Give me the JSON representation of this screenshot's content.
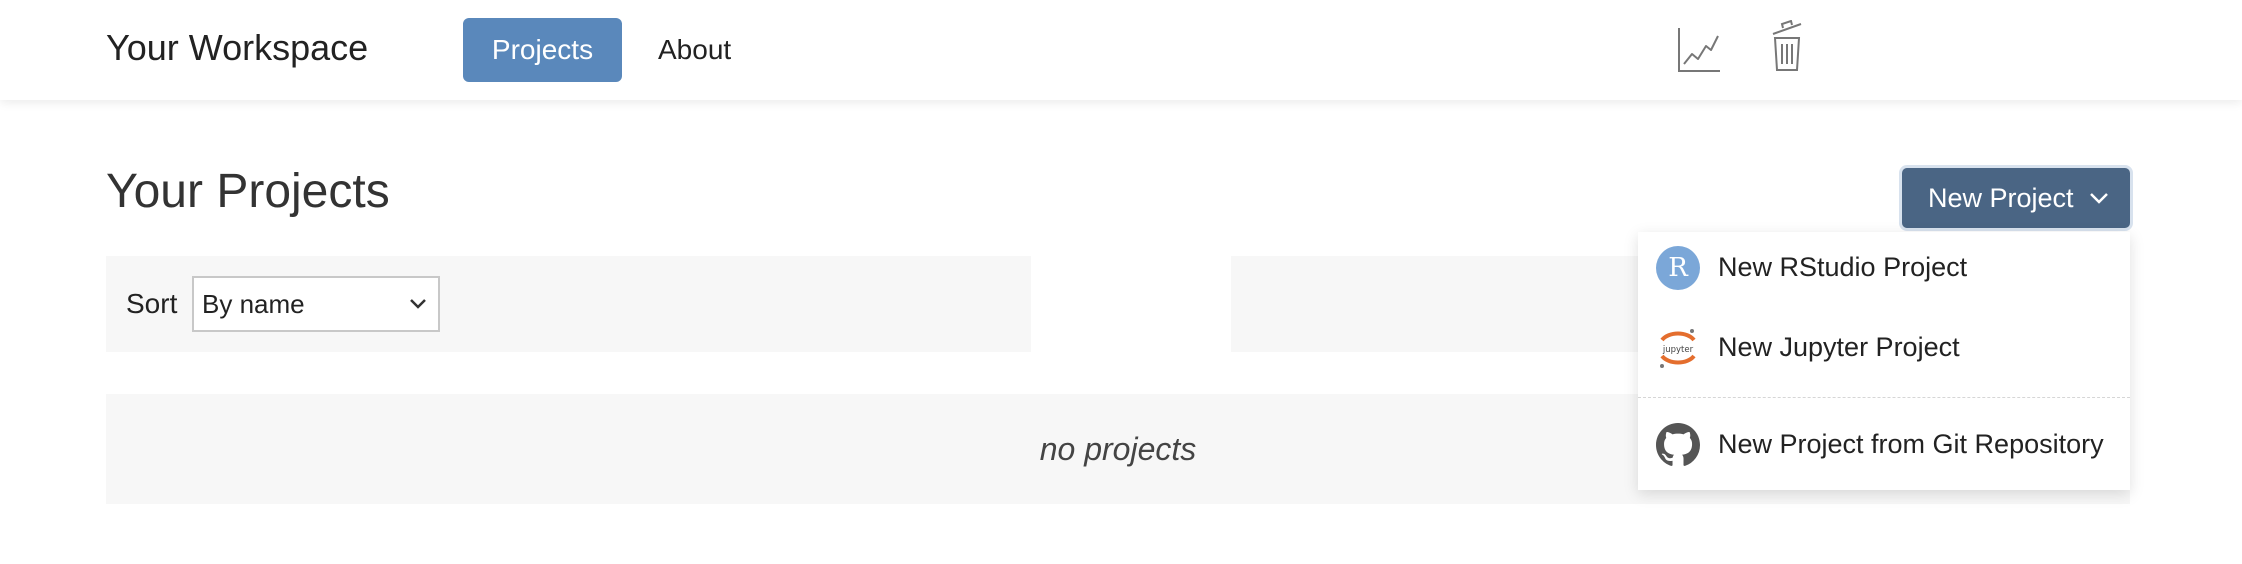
{
  "header": {
    "brand": "Your Workspace",
    "nav": {
      "projects": "Projects",
      "about": "About"
    },
    "icons": [
      "line-chart-icon",
      "trash-icon"
    ],
    "accent_color": "#5a88bb"
  },
  "main": {
    "title": "Your Projects",
    "new_project_button": {
      "label": "New Project",
      "color": "#4a6584"
    },
    "sort": {
      "label": "Sort",
      "selected": "By name"
    },
    "empty_state": "no projects"
  },
  "dropdown": {
    "items": [
      {
        "label": "New RStudio Project",
        "icon": "rstudio-icon",
        "badge": "R"
      },
      {
        "label": "New Jupyter Project",
        "icon": "jupyter-icon",
        "badge": "jupyter"
      },
      {
        "label": "New Project from Git Repository",
        "icon": "github-icon"
      }
    ]
  }
}
